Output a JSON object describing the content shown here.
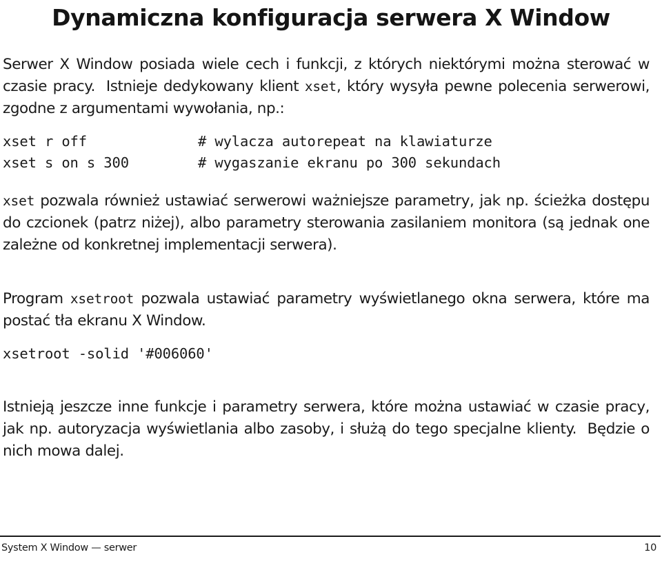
{
  "slide": {
    "title": "Dynamiczna konfiguracja serwera X Window",
    "paragraph_1": {
      "part_a": "Serwer X Window posiada wiele cech i funkcji, z których niektórymi można sterować w czasie pracy.",
      "part_b": "Istnieje dedykowany klient ",
      "mono_1": "xset",
      "part_c": ", który wysyła pewne polecenia serwerowi, zgodne z argumentami wywołania, np.:"
    },
    "code_block_1": {
      "lines": [
        {
          "command": "xset r off",
          "comment": "# wylacza autorepeat na klawiaturze"
        },
        {
          "command": "xset s on s 300",
          "comment": "# wygaszanie ekranu po 300 sekundach"
        }
      ]
    },
    "paragraph_2": {
      "mono_1": "xset",
      "text": " pozwala również ustawiać serwerowi ważniejsze parametry, jak np. ścieżka dostępu do czcionek (patrz niżej), albo parametry sterowania zasilaniem monitora (są jednak one zależne od konkretnej implementacji serwera)."
    },
    "paragraph_3": {
      "part_a": "Program ",
      "mono_1": "xsetroot",
      "part_b": " pozwala ustawiać parametry wyświetlanego okna serwera, które ma postać tła ekranu X Window."
    },
    "code_block_2": {
      "lines": [
        {
          "command": "xsetroot -solid '#006060'",
          "comment": ""
        }
      ]
    },
    "paragraph_4": {
      "part_a": "Istnieją jeszcze inne funkcje i parametry serwera, które można ustawiać w czasie pracy, jak np. autoryzacja wyświetlania albo zasoby, i służą do tego specjalne klienty.",
      "part_b": "Będzie o nich mowa dalej."
    }
  },
  "footer": {
    "left_label": "System X Window — serwer",
    "page_number": "10"
  },
  "colors": {
    "text": "#1a1a1a",
    "background": "#ffffff",
    "rule": "#1a1a1a"
  }
}
